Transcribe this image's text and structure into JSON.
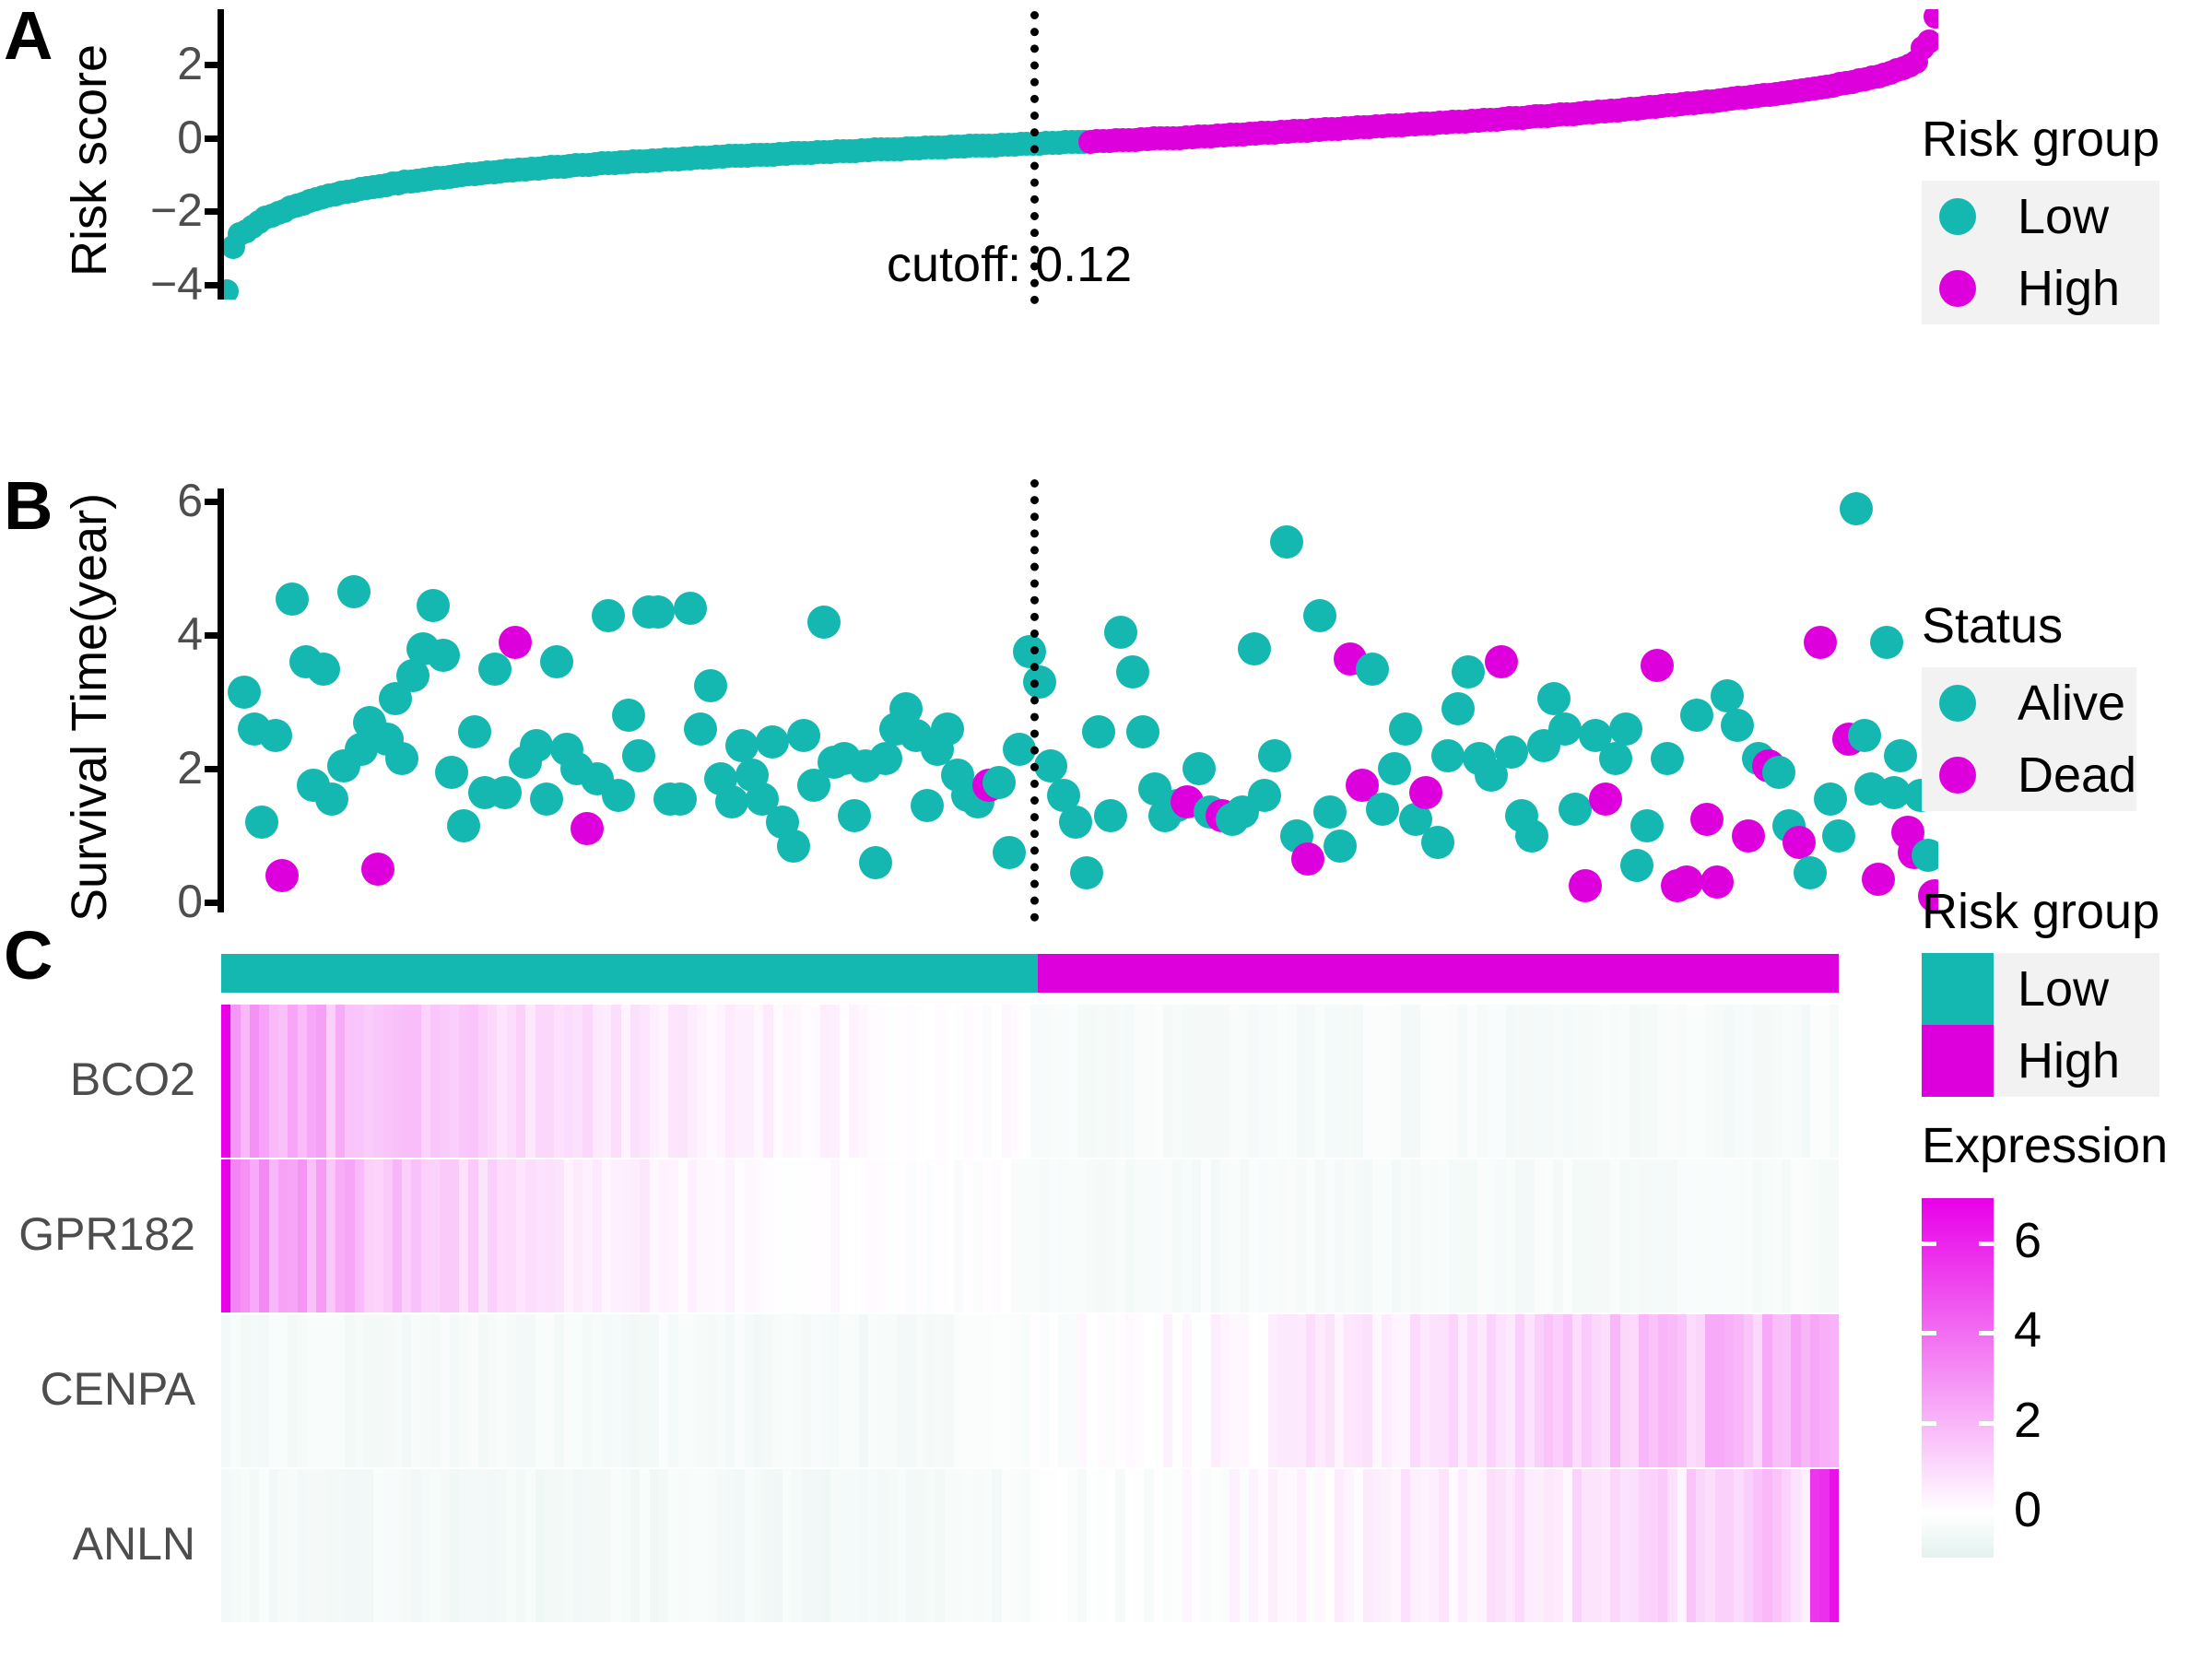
{
  "figure": {
    "panels": [
      {
        "letter": "A",
        "name": "risk-score-panel"
      },
      {
        "letter": "B",
        "name": "survival-time-panel"
      },
      {
        "letter": "C",
        "name": "expression-heatmap-panel"
      }
    ]
  },
  "colors": {
    "low_teal": "#14b8b0",
    "high_magenta": "#dd00dd",
    "alive_teal": "#14b8b0",
    "dead_magenta": "#dd00dd",
    "axis": "#000000",
    "tick_text": "#4d4d4d",
    "legend_key_bg": "#f2f2f2",
    "expr_high": "#e800e8",
    "expr_mid": "#ffffff",
    "expr_low": "#e4f2ef"
  },
  "panelA": {
    "ylabel": "Risk score",
    "yticks": [
      "2",
      "0",
      "−2",
      "−4"
    ],
    "ytick_values": [
      2,
      0,
      -2,
      -4
    ],
    "cutoff_label": "cutoff: 0.12",
    "cutoff_value": 0.12
  },
  "panelB": {
    "ylabel": "Survival Time(year)",
    "yticks": [
      "6",
      "4",
      "2",
      "0"
    ],
    "ytick_values": [
      6,
      4,
      2,
      0
    ]
  },
  "panelC": {
    "row_labels": [
      "BCO2",
      "GPR182",
      "CENPA",
      "ANLN"
    ]
  },
  "legends": [
    {
      "name": "risk-group-points",
      "title": "Risk group",
      "marker": "dot",
      "items": [
        {
          "label": "Low",
          "color": "#14b8b0"
        },
        {
          "label": "High",
          "color": "#dd00dd"
        }
      ]
    },
    {
      "name": "status-points",
      "title": "Status",
      "marker": "dot",
      "items": [
        {
          "label": "Alive",
          "color": "#14b8b0"
        },
        {
          "label": "Dead",
          "color": "#dd00dd"
        }
      ]
    },
    {
      "name": "risk-group-heatmap",
      "title": "Risk group",
      "marker": "square",
      "items": [
        {
          "label": "Low",
          "color": "#14b8b0"
        },
        {
          "label": "High",
          "color": "#dd00dd"
        }
      ]
    }
  ],
  "colorbar": {
    "name": "expression-colorbar",
    "title": "Expression",
    "ticks": [
      "6",
      "4",
      "2",
      "0"
    ],
    "tick_values": [
      6,
      4,
      2,
      0
    ],
    "range": [
      -1,
      7
    ]
  },
  "chart_data": [
    {
      "type": "scatter",
      "name": "panel-A-risk-score",
      "title": "A",
      "xlabel": "",
      "ylabel": "Risk score",
      "ylim": [
        -4.4,
        3.5
      ],
      "grid": false,
      "annotations": [
        {
          "text": "cutoff: 0.12",
          "x": 0.505,
          "y": -0.6
        }
      ],
      "series": [
        {
          "name": "Low",
          "color": "#14b8b0"
        },
        {
          "name": "High",
          "color": "#dd00dd"
        }
      ],
      "cutoff_index": 0.5046,
      "values": [
        -4.18,
        -2.96,
        -2.62,
        -2.54,
        -2.42,
        -2.3,
        -2.18,
        -2.12,
        -2.05,
        -1.98,
        -1.9,
        -1.84,
        -1.78,
        -1.72,
        -1.66,
        -1.62,
        -1.57,
        -1.53,
        -1.5,
        -1.47,
        -1.43,
        -1.4,
        -1.36,
        -1.33,
        -1.31,
        -1.28,
        -1.25,
        -1.23,
        -1.2,
        -1.18,
        -1.16,
        -1.14,
        -1.12,
        -1.1,
        -1.08,
        -1.06,
        -1.04,
        -1.02,
        -1.0,
        -0.99,
        -0.97,
        -0.95,
        -0.94,
        -0.92,
        -0.9,
        -0.89,
        -0.87,
        -0.86,
        -0.84,
        -0.83,
        -0.82,
        -0.8,
        -0.79,
        -0.78,
        -0.76,
        -0.75,
        -0.74,
        -0.73,
        -0.71,
        -0.7,
        -0.69,
        -0.68,
        -0.67,
        -0.66,
        -0.65,
        -0.64,
        -0.63,
        -0.62,
        -0.61,
        -0.6,
        -0.59,
        -0.58,
        -0.57,
        -0.56,
        -0.55,
        -0.54,
        -0.53,
        -0.52,
        -0.51,
        -0.5,
        -0.5,
        -0.49,
        -0.48,
        -0.47,
        -0.46,
        -0.45,
        -0.45,
        -0.44,
        -0.43,
        -0.42,
        -0.41,
        -0.41,
        -0.4,
        -0.39,
        -0.38,
        -0.38,
        -0.37,
        -0.36,
        -0.35,
        -0.35,
        -0.34,
        -0.33,
        -0.32,
        -0.32,
        -0.31,
        -0.3,
        -0.3,
        -0.29,
        -0.28,
        -0.28,
        -0.27,
        -0.26,
        -0.26,
        -0.25,
        -0.24,
        -0.24,
        -0.23,
        -0.22,
        -0.22,
        -0.21,
        -0.2,
        -0.2,
        -0.19,
        -0.18,
        -0.18,
        -0.17,
        -0.16,
        -0.16,
        -0.15,
        -0.14,
        -0.14,
        -0.13,
        -0.12,
        -0.12,
        -0.11,
        -0.1,
        -0.1,
        -0.09,
        -0.08,
        -0.08,
        -0.07,
        -0.06,
        -0.05,
        -0.05,
        -0.04,
        -0.03,
        -0.02,
        -0.02,
        -0.01,
        0.0,
        0.0,
        0.01,
        0.02,
        0.03,
        0.04,
        0.05,
        0.06,
        0.07,
        0.08,
        0.09,
        0.1,
        0.11,
        0.12,
        0.13,
        0.14,
        0.15,
        0.16,
        0.17,
        0.18,
        0.19,
        0.2,
        0.21,
        0.22,
        0.23,
        0.24,
        0.25,
        0.26,
        0.27,
        0.28,
        0.29,
        0.3,
        0.31,
        0.32,
        0.33,
        0.34,
        0.35,
        0.36,
        0.37,
        0.38,
        0.39,
        0.4,
        0.41,
        0.42,
        0.43,
        0.44,
        0.45,
        0.46,
        0.47,
        0.48,
        0.49,
        0.5,
        0.52,
        0.53,
        0.54,
        0.55,
        0.56,
        0.58,
        0.59,
        0.6,
        0.61,
        0.63,
        0.64,
        0.65,
        0.67,
        0.68,
        0.69,
        0.71,
        0.72,
        0.74,
        0.75,
        0.77,
        0.78,
        0.8,
        0.81,
        0.83,
        0.85,
        0.86,
        0.88,
        0.9,
        0.91,
        0.93,
        0.95,
        0.97,
        0.99,
        1.0,
        1.02,
        1.04,
        1.06,
        1.08,
        1.1,
        1.12,
        1.14,
        1.16,
        1.18,
        1.2,
        1.22,
        1.25,
        1.27,
        1.29,
        1.32,
        1.34,
        1.37,
        1.4,
        1.43,
        1.46,
        1.49,
        1.52,
        1.56,
        1.6,
        1.64,
        1.68,
        1.73,
        1.78,
        1.84,
        1.9,
        1.98,
        2.07,
        2.45,
        2.62,
        3.3
      ]
    },
    {
      "type": "scatter",
      "name": "panel-B-survival-time",
      "title": "B",
      "xlabel": "",
      "ylabel": "Survival Time(year)",
      "ylim": [
        -0.15,
        6.2
      ],
      "grid": false,
      "series": [
        {
          "name": "Alive",
          "color": "#14b8b0"
        },
        {
          "name": "Dead",
          "color": "#dd00dd"
        }
      ],
      "points": [
        [
          0.012,
          3.15,
          "Alive"
        ],
        [
          0.018,
          2.6,
          "Alive"
        ],
        [
          0.022,
          1.2,
          "Alive"
        ],
        [
          0.03,
          2.5,
          "Alive"
        ],
        [
          0.034,
          0.4,
          "Dead"
        ],
        [
          0.04,
          4.55,
          "Alive"
        ],
        [
          0.048,
          3.6,
          "Alive"
        ],
        [
          0.052,
          1.75,
          "Alive"
        ],
        [
          0.058,
          3.5,
          "Alive"
        ],
        [
          0.063,
          1.55,
          "Alive"
        ],
        [
          0.07,
          2.05,
          "Alive"
        ],
        [
          0.076,
          4.65,
          "Alive"
        ],
        [
          0.08,
          2.3,
          "Alive"
        ],
        [
          0.085,
          2.7,
          "Alive"
        ],
        [
          0.09,
          0.5,
          "Dead"
        ],
        [
          0.095,
          2.45,
          "Alive"
        ],
        [
          0.1,
          3.05,
          "Alive"
        ],
        [
          0.104,
          2.15,
          "Alive"
        ],
        [
          0.11,
          3.4,
          "Alive"
        ],
        [
          0.116,
          3.8,
          "Alive"
        ],
        [
          0.122,
          4.45,
          "Alive"
        ],
        [
          0.128,
          3.7,
          "Alive"
        ],
        [
          0.133,
          1.95,
          "Alive"
        ],
        [
          0.14,
          1.15,
          "Alive"
        ],
        [
          0.146,
          2.55,
          "Alive"
        ],
        [
          0.152,
          1.65,
          "Alive"
        ],
        [
          0.158,
          3.5,
          "Alive"
        ],
        [
          0.164,
          1.65,
          "Alive"
        ],
        [
          0.17,
          3.9,
          "Dead"
        ],
        [
          0.176,
          2.1,
          "Alive"
        ],
        [
          0.182,
          2.35,
          "Alive"
        ],
        [
          0.188,
          1.55,
          "Alive"
        ],
        [
          0.194,
          3.6,
          "Alive"
        ],
        [
          0.2,
          2.3,
          "Alive"
        ],
        [
          0.206,
          2.0,
          "Alive"
        ],
        [
          0.212,
          1.1,
          "Dead"
        ],
        [
          0.218,
          1.85,
          "Alive"
        ],
        [
          0.224,
          4.3,
          "Alive"
        ],
        [
          0.23,
          1.6,
          "Alive"
        ],
        [
          0.236,
          2.8,
          "Alive"
        ],
        [
          0.242,
          2.2,
          "Alive"
        ],
        [
          0.248,
          4.35,
          "Alive"
        ],
        [
          0.253,
          4.35,
          "Alive"
        ],
        [
          0.26,
          1.55,
          "Alive"
        ],
        [
          0.266,
          1.55,
          "Alive"
        ],
        [
          0.272,
          4.4,
          "Alive"
        ],
        [
          0.278,
          2.6,
          "Alive"
        ],
        [
          0.284,
          3.25,
          "Alive"
        ],
        [
          0.29,
          1.85,
          "Alive"
        ],
        [
          0.296,
          1.5,
          "Alive"
        ],
        [
          0.302,
          2.35,
          "Alive"
        ],
        [
          0.308,
          1.9,
          "Alive"
        ],
        [
          0.314,
          1.55,
          "Alive"
        ],
        [
          0.32,
          2.4,
          "Alive"
        ],
        [
          0.326,
          1.2,
          "Alive"
        ],
        [
          0.332,
          0.85,
          "Alive"
        ],
        [
          0.338,
          2.5,
          "Alive"
        ],
        [
          0.344,
          1.75,
          "Alive"
        ],
        [
          0.35,
          4.2,
          "Alive"
        ],
        [
          0.356,
          2.1,
          "Alive"
        ],
        [
          0.362,
          2.15,
          "Alive"
        ],
        [
          0.368,
          1.3,
          "Alive"
        ],
        [
          0.374,
          2.05,
          "Alive"
        ],
        [
          0.38,
          0.6,
          "Alive"
        ],
        [
          0.386,
          2.15,
          "Alive"
        ],
        [
          0.392,
          2.6,
          "Alive"
        ],
        [
          0.398,
          2.9,
          "Alive"
        ],
        [
          0.404,
          2.5,
          "Alive"
        ],
        [
          0.41,
          1.45,
          "Alive"
        ],
        [
          0.416,
          2.3,
          "Alive"
        ],
        [
          0.422,
          2.6,
          "Alive"
        ],
        [
          0.428,
          1.9,
          "Alive"
        ],
        [
          0.434,
          1.6,
          "Alive"
        ],
        [
          0.44,
          1.5,
          "Alive"
        ],
        [
          0.446,
          1.75,
          "Dead"
        ],
        [
          0.452,
          1.8,
          "Alive"
        ],
        [
          0.458,
          0.75,
          "Alive"
        ],
        [
          0.464,
          2.3,
          "Alive"
        ],
        [
          0.47,
          3.75,
          "Alive"
        ],
        [
          0.476,
          3.3,
          "Alive"
        ],
        [
          0.482,
          2.05,
          "Alive"
        ],
        [
          0.49,
          1.6,
          "Alive"
        ],
        [
          0.497,
          1.2,
          "Alive"
        ],
        [
          0.503,
          0.45,
          "Alive"
        ],
        [
          0.51,
          2.55,
          "Alive"
        ],
        [
          0.517,
          1.3,
          "Alive"
        ],
        [
          0.523,
          4.05,
          "Alive"
        ],
        [
          0.53,
          3.45,
          "Alive"
        ],
        [
          0.536,
          2.55,
          "Alive"
        ],
        [
          0.543,
          1.7,
          "Alive"
        ],
        [
          0.549,
          1.3,
          "Alive"
        ],
        [
          0.556,
          1.45,
          "Alive"
        ],
        [
          0.562,
          1.5,
          "Dead"
        ],
        [
          0.569,
          2.0,
          "Alive"
        ],
        [
          0.575,
          1.35,
          "Alive"
        ],
        [
          0.582,
          1.3,
          "Dead"
        ],
        [
          0.588,
          1.25,
          "Alive"
        ],
        [
          0.594,
          1.35,
          "Alive"
        ],
        [
          0.601,
          3.8,
          "Alive"
        ],
        [
          0.607,
          1.6,
          "Alive"
        ],
        [
          0.613,
          2.2,
          "Alive"
        ],
        [
          0.62,
          5.4,
          "Alive"
        ],
        [
          0.626,
          1.0,
          "Alive"
        ],
        [
          0.632,
          0.65,
          "Dead"
        ],
        [
          0.639,
          4.3,
          "Alive"
        ],
        [
          0.645,
          1.35,
          "Alive"
        ],
        [
          0.651,
          0.85,
          "Alive"
        ],
        [
          0.657,
          3.65,
          "Dead"
        ],
        [
          0.664,
          1.75,
          "Dead"
        ],
        [
          0.67,
          3.5,
          "Alive"
        ],
        [
          0.676,
          1.4,
          "Alive"
        ],
        [
          0.683,
          2.0,
          "Alive"
        ],
        [
          0.689,
          2.6,
          "Alive"
        ],
        [
          0.695,
          1.25,
          "Alive"
        ],
        [
          0.701,
          1.65,
          "Dead"
        ],
        [
          0.708,
          0.9,
          "Alive"
        ],
        [
          0.714,
          2.2,
          "Alive"
        ],
        [
          0.72,
          2.9,
          "Alive"
        ],
        [
          0.726,
          3.45,
          "Alive"
        ],
        [
          0.732,
          2.15,
          "Alive"
        ],
        [
          0.739,
          1.9,
          "Alive"
        ],
        [
          0.745,
          3.6,
          "Dead"
        ],
        [
          0.751,
          2.25,
          "Alive"
        ],
        [
          0.757,
          1.3,
          "Alive"
        ],
        [
          0.763,
          1.0,
          "Alive"
        ],
        [
          0.77,
          2.35,
          "Alive"
        ],
        [
          0.776,
          3.05,
          "Alive"
        ],
        [
          0.782,
          2.6,
          "Alive"
        ],
        [
          0.788,
          1.4,
          "Alive"
        ],
        [
          0.794,
          0.25,
          "Dead"
        ],
        [
          0.8,
          2.5,
          "Alive"
        ],
        [
          0.806,
          1.55,
          "Dead"
        ],
        [
          0.812,
          2.15,
          "Alive"
        ],
        [
          0.818,
          2.6,
          "Alive"
        ],
        [
          0.824,
          0.55,
          "Alive"
        ],
        [
          0.83,
          1.15,
          "Alive"
        ],
        [
          0.836,
          3.55,
          "Dead"
        ],
        [
          0.842,
          2.15,
          "Alive"
        ],
        [
          0.848,
          0.25,
          "Dead"
        ],
        [
          0.853,
          0.3,
          "Dead"
        ],
        [
          0.859,
          2.8,
          "Alive"
        ],
        [
          0.865,
          1.25,
          "Dead"
        ],
        [
          0.871,
          0.3,
          "Dead"
        ],
        [
          0.877,
          3.1,
          "Alive"
        ],
        [
          0.883,
          2.65,
          "Alive"
        ],
        [
          0.889,
          1.0,
          "Dead"
        ],
        [
          0.895,
          2.15,
          "Alive"
        ],
        [
          0.901,
          2.05,
          "Dead"
        ],
        [
          0.907,
          1.95,
          "Alive"
        ],
        [
          0.913,
          1.15,
          "Alive"
        ],
        [
          0.919,
          0.9,
          "Dead"
        ],
        [
          0.925,
          0.45,
          "Alive"
        ],
        [
          0.931,
          3.9,
          "Dead"
        ],
        [
          0.937,
          1.55,
          "Alive"
        ],
        [
          0.942,
          1.0,
          "Alive"
        ],
        [
          0.948,
          2.45,
          "Dead"
        ],
        [
          0.952,
          5.9,
          "Alive"
        ],
        [
          0.957,
          2.5,
          "Alive"
        ],
        [
          0.961,
          1.7,
          "Alive"
        ],
        [
          0.965,
          0.35,
          "Dead"
        ],
        [
          0.97,
          3.9,
          "Alive"
        ],
        [
          0.974,
          1.65,
          "Alive"
        ],
        [
          0.978,
          2.2,
          "Alive"
        ],
        [
          0.982,
          1.05,
          "Dead"
        ],
        [
          0.986,
          0.75,
          "Dead"
        ],
        [
          0.99,
          1.6,
          "Alive"
        ],
        [
          0.994,
          0.7,
          "Alive"
        ],
        [
          0.998,
          0.1,
          "Dead"
        ]
      ]
    },
    {
      "type": "heatmap",
      "name": "panel-C-expression-heatmap",
      "title": "C",
      "rows": [
        "BCO2",
        "GPR182",
        "CENPA",
        "ANLN"
      ],
      "zlim": [
        -1,
        7
      ],
      "colorbar_title": "Expression",
      "annotation_track": {
        "low_fraction": 0.5046,
        "low_color": "#14b8b0",
        "high_color": "#dd00dd"
      },
      "ncols": 170,
      "row_profiles": {
        "BCO2": {
          "low_mean": 2.6,
          "high_mean": -0.3,
          "falloff": 2.4
        },
        "GPR182": {
          "low_mean": 3.1,
          "high_mean": -0.3,
          "falloff": 3.2
        },
        "CENPA": {
          "low_mean": -0.35,
          "high_mean": 1.9,
          "rise": 2.6
        },
        "ANLN": {
          "low_mean": -0.4,
          "high_mean": 1.2,
          "rise": 4.0
        }
      }
    }
  ]
}
